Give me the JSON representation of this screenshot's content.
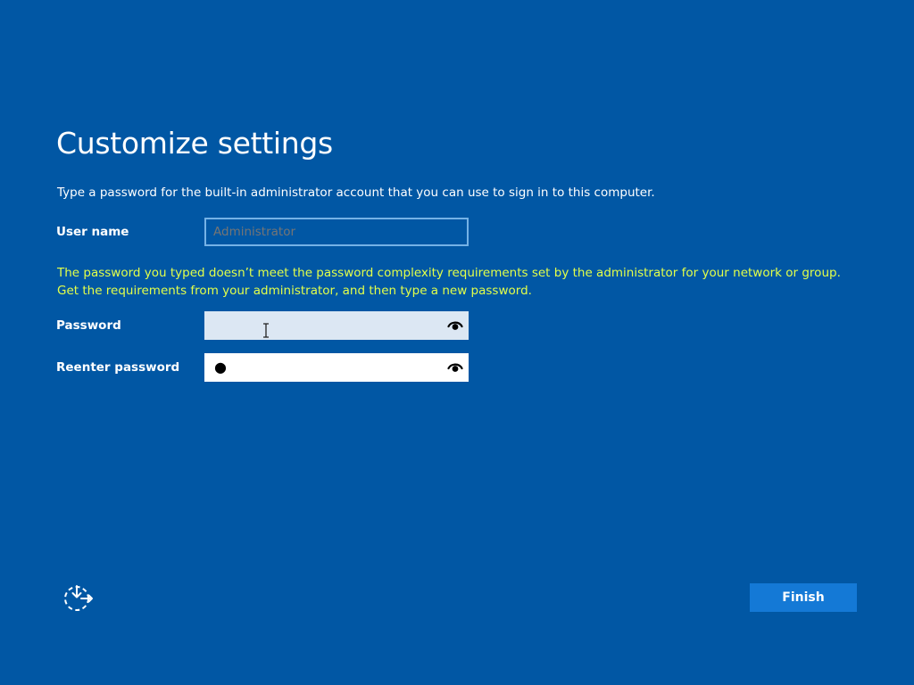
{
  "page": {
    "title": "Customize settings",
    "instructions": "Type a password for the built-in administrator account that you can use to sign in to this computer.",
    "error_message": "The password you typed doesn’t meet the password complexity requirements set by the administrator for your network or group. Get the requirements from your administrator, and then type a new password."
  },
  "form": {
    "username_label": "User name",
    "username_placeholder": "Administrator",
    "password_label": "Password",
    "password_value": "",
    "reenter_label": "Reenter password",
    "reenter_mask": "●"
  },
  "footer": {
    "accessibility_icon": "ease-of-access-icon",
    "finish_label": "Finish"
  },
  "colors": {
    "background": "#0157a4",
    "error_text": "#e3ff4a",
    "button": "#1479d6"
  }
}
